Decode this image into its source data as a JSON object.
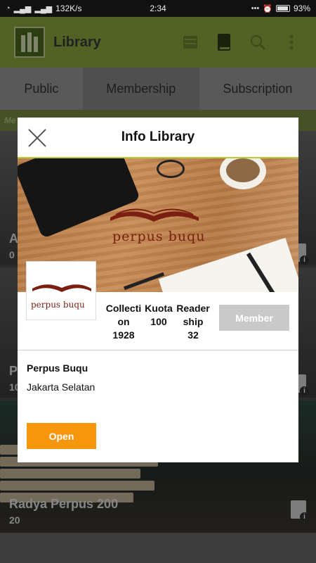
{
  "status_bar": {
    "network_speed": "132K/s",
    "time": "2:34",
    "battery": "93%"
  },
  "app_bar": {
    "title": "Library",
    "icons": [
      "library-logo-icon",
      "shelf-icon",
      "book-icon",
      "search-icon",
      "more-vert-icon"
    ]
  },
  "tabs": [
    {
      "label": "Public"
    },
    {
      "label": "Membership"
    },
    {
      "label": "Subscription"
    }
  ],
  "tab_section_label": "Me",
  "background_list": [
    {
      "title": "A",
      "count": "0"
    },
    {
      "title": "P",
      "count": "10"
    },
    {
      "title": "Radya Perpus 200",
      "count": "20"
    }
  ],
  "dialog": {
    "title": "Info Library",
    "banner_text": "perpus buqu",
    "thumb_text": "perpus buqu",
    "stats": {
      "collection_label_1": "Collecti",
      "collection_label_2": "on",
      "collection_value": "1928",
      "quota_label": "Kuota",
      "quota_value": "100",
      "readership_label_1": "Reader",
      "readership_label_2": "ship",
      "readership_value": "32"
    },
    "member_button": "Member",
    "library_name": "Perpus Buqu",
    "library_location": "Jakarta Selatan",
    "open_button": "Open"
  },
  "colors": {
    "app_bar": "#8ea73f",
    "open_button": "#f6960d",
    "member_button_disabled": "#c9c9c9",
    "brand_text": "#7a1f12"
  }
}
